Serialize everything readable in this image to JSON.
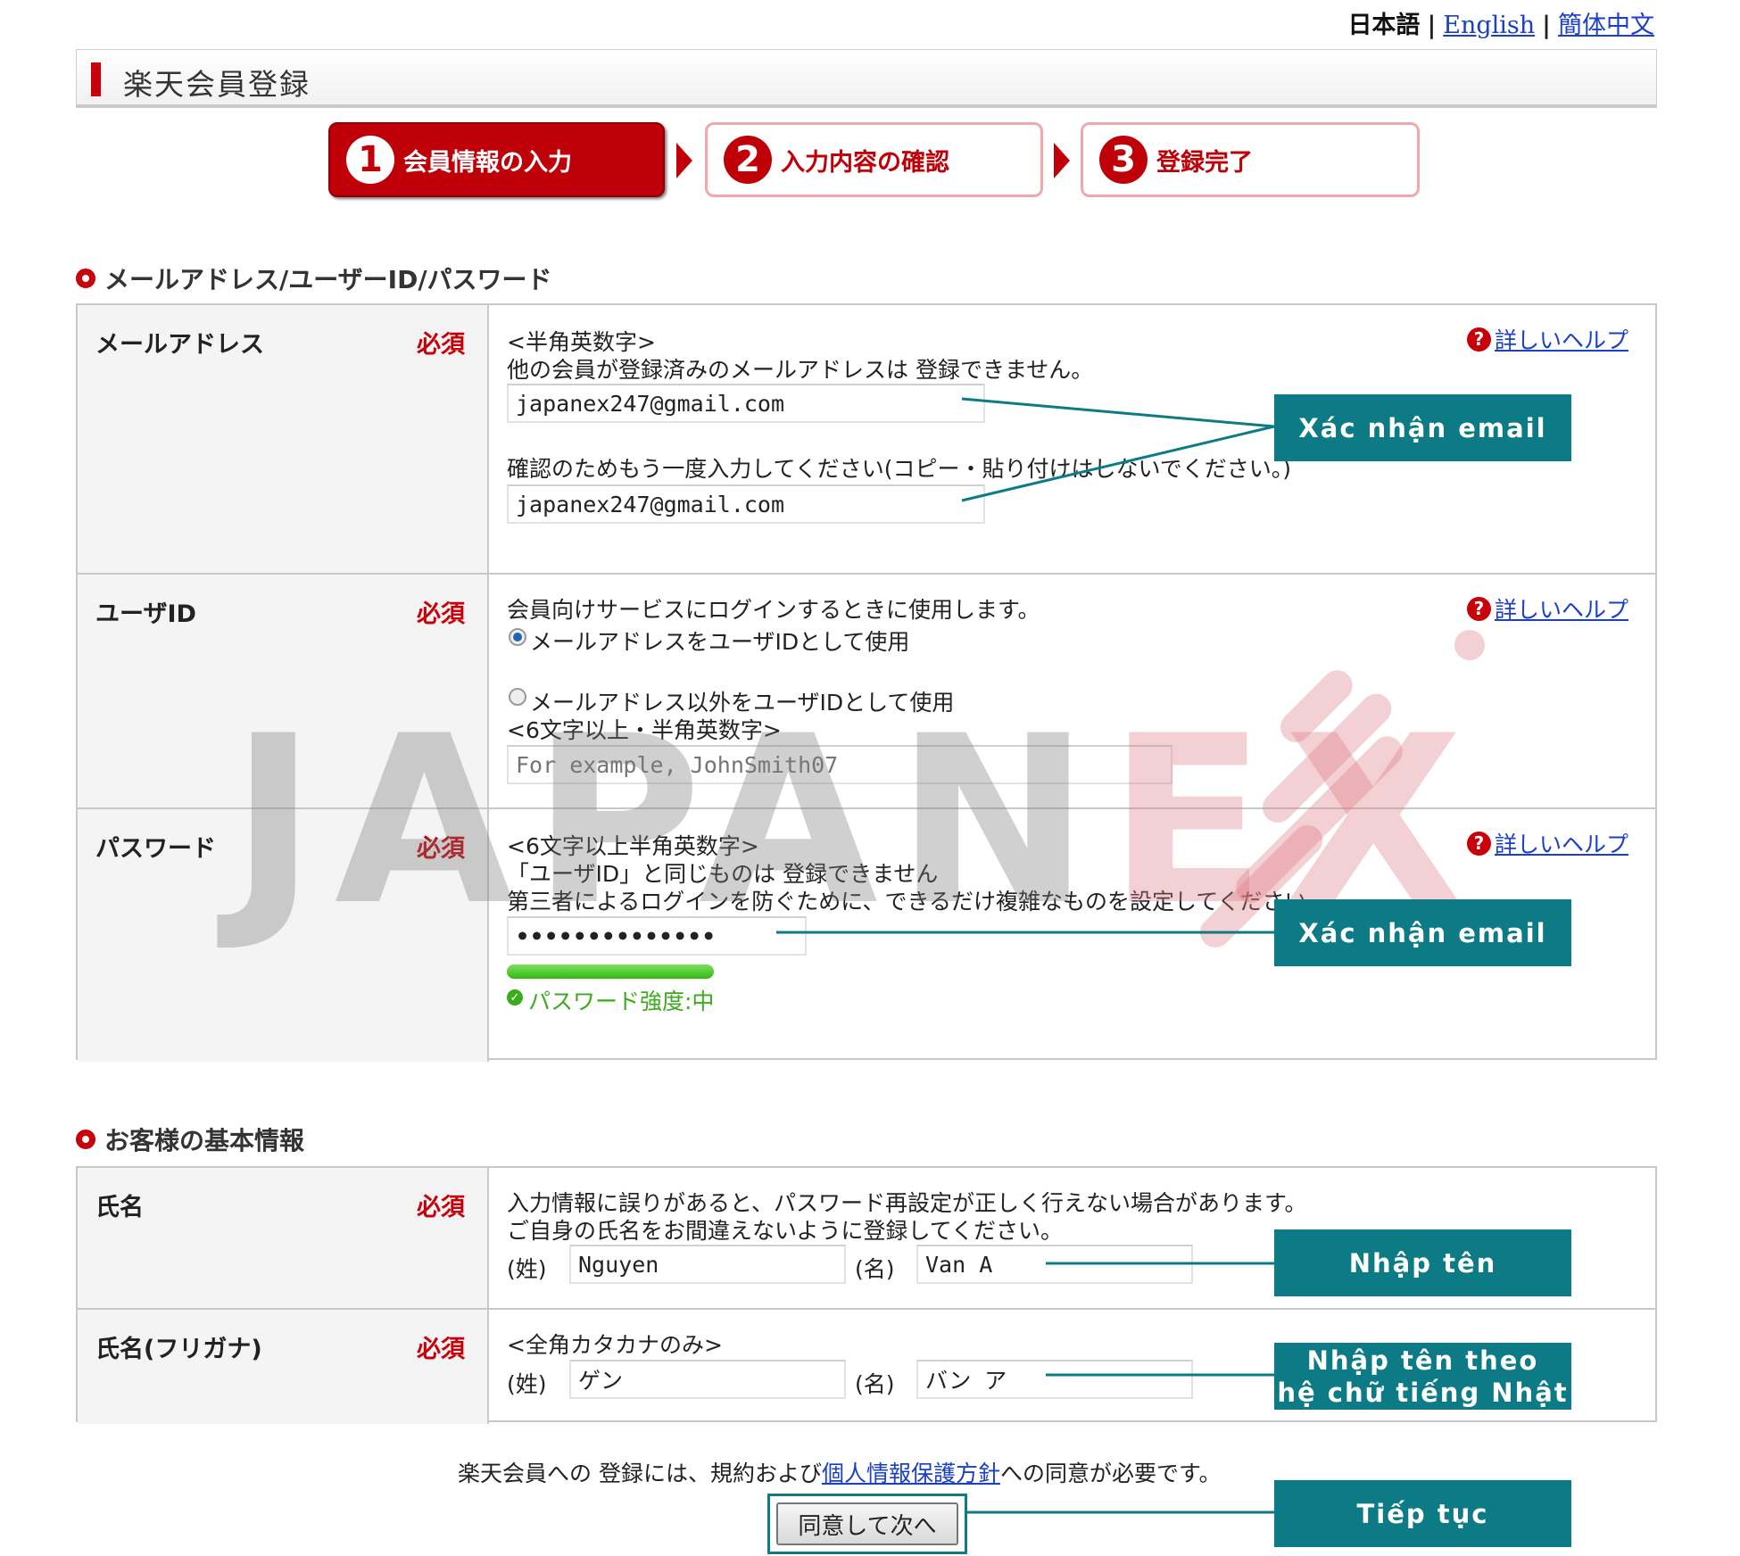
{
  "lang": {
    "current": "日本語",
    "english": "English",
    "chinese": "簡体中文"
  },
  "title": "楽天会員登録",
  "steps": [
    {
      "num": "1",
      "label": "会員情報の入力"
    },
    {
      "num": "2",
      "label": "入力内容の確認"
    },
    {
      "num": "3",
      "label": "登録完了"
    }
  ],
  "section1": {
    "title": "メールアドレス/ユーザーID/パスワード"
  },
  "required": "必須",
  "help": "詳しいヘルプ",
  "email": {
    "label": "メールアドレス",
    "hint1": "<半角英数字>",
    "hint2": "他の会員が登録済みのメールアドレスは 登録できません。",
    "value": "japanex247@gmail.com",
    "confirm_hint": "確認のためもう一度入力してください(コピー・貼り付けはしないでください。)",
    "confirm_value": "japanex247@gmail.com"
  },
  "userid": {
    "label": "ユーザID",
    "hint": "会員向けサービスにログインするときに使用します。",
    "option1": "メールアドレスをユーザIDとして使用",
    "option2": "メールアドレス以外をユーザIDとして使用",
    "option2_hint": "<6文字以上・半角英数字>",
    "placeholder": "For example, JohnSmith07"
  },
  "password": {
    "label": "パスワード",
    "hint1": "<6文字以上半角英数字>",
    "hint2": "「ユーザID」と同じものは 登録できません",
    "hint3": "第三者によるログインを防ぐために、できるだけ複雑なものを設定してください。",
    "value": "••••••••••••••",
    "strength_label": "パスワード強度:中",
    "strength_fraction": 1.0
  },
  "section2": {
    "title": "お客様の基本情報"
  },
  "name": {
    "label": "氏名",
    "hint1": "入力情報に誤りがあると、パスワード再設定が正しく行えない場合があります。",
    "hint2": "ご自身の氏名をお間違えないように登録してください。",
    "sei": "(姓)",
    "mei": "(名)",
    "last": "Nguyen",
    "first": "Van A"
  },
  "kana": {
    "label": "氏名(フリガナ)",
    "hint": "<全角カタカナのみ>",
    "sei": "(姓)",
    "mei": "(名)",
    "last": "ゲン",
    "first": "バン ア"
  },
  "agree": {
    "pre": "楽天会員への 登録には、規約および",
    "link": "個人情報保護方針",
    "post": "への同意が必要です。"
  },
  "next_button": "同意して次へ",
  "watermark": {
    "part1": "JAPAN",
    "part2": "EX"
  },
  "callouts": {
    "email": "Xác nhận email",
    "password": "Xác nhận email",
    "name": "Nhập tên",
    "kana_line1": "Nhập tên theo",
    "kana_line2": "hệ chữ tiếng Nhật",
    "next": "Tiếp tục"
  },
  "colors": {
    "brand_red": "#c8000a",
    "callout_teal": "#0c7b85",
    "link_blue": "#1a3fc8",
    "strength_green": "#3cc21e"
  }
}
